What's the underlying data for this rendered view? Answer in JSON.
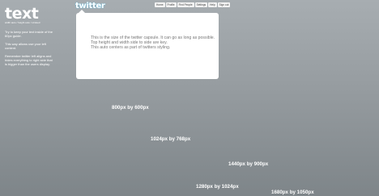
{
  "sidebar": {
    "title": "text",
    "subtitle": "width auto / height auto / stroked",
    "paragraphs": [
      "Try to keep your text inside of the 60px guide.",
      "This way allows use your left content.",
      "Remember twitter left aligns and hides everything to right side that is bigger than the users display."
    ]
  },
  "header": {
    "logo": "twitter",
    "nav": [
      "Home",
      "Profile",
      "Find People",
      "Settings",
      "Help",
      "Sign out"
    ]
  },
  "capsule": {
    "lines": [
      "This is the size of the twitter capsule. It can go as long as possible.",
      "Top height and width side to side are key.",
      "This auto centers as part of twitters styling."
    ]
  },
  "guides": {
    "labels": [
      "800px by 600px",
      "1024px by 768px",
      "1440px by 900px",
      "1280px by 1024px",
      "1680px by 1050px"
    ]
  }
}
